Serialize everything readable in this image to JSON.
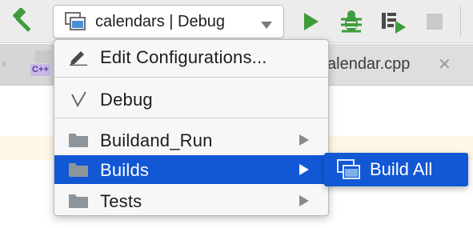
{
  "toolbar": {
    "build_icon": "hammer-icon",
    "configuration_selector": {
      "label": "calendars | Debug",
      "icon": "run-configuration-icon",
      "dropdown_icon": "chevron-down-icon"
    },
    "run_icon": "run-icon",
    "debug_icon": "debug-icon",
    "profile_icon": "run-with-profiler-icon",
    "stop_icon": "stop-icon",
    "colors": {
      "run": "#3e9c3a",
      "stop": "#c9c9c9"
    }
  },
  "tabs": {
    "left_tab": {
      "badge": "C++",
      "icon": "cpp-file-icon"
    },
    "active_tab": {
      "label": "alendar.cpp",
      "close_icon": "close-icon"
    }
  },
  "configurations_menu": {
    "items": [
      {
        "label": "Edit Configurations...",
        "icon": "pencil-icon"
      },
      {
        "label": "Debug",
        "icon": "checkmark-icon"
      },
      {
        "label": "Buildand_Run",
        "icon": "folder-icon",
        "has_submenu": true
      },
      {
        "label": "Builds",
        "icon": "folder-icon",
        "has_submenu": true,
        "selected": true
      },
      {
        "label": "Tests",
        "icon": "folder-icon",
        "has_submenu": true
      }
    ],
    "submenu": {
      "items": [
        {
          "label": "Build All",
          "icon": "run-configuration-icon"
        }
      ]
    },
    "colors": {
      "selection": "#1257d4"
    }
  }
}
